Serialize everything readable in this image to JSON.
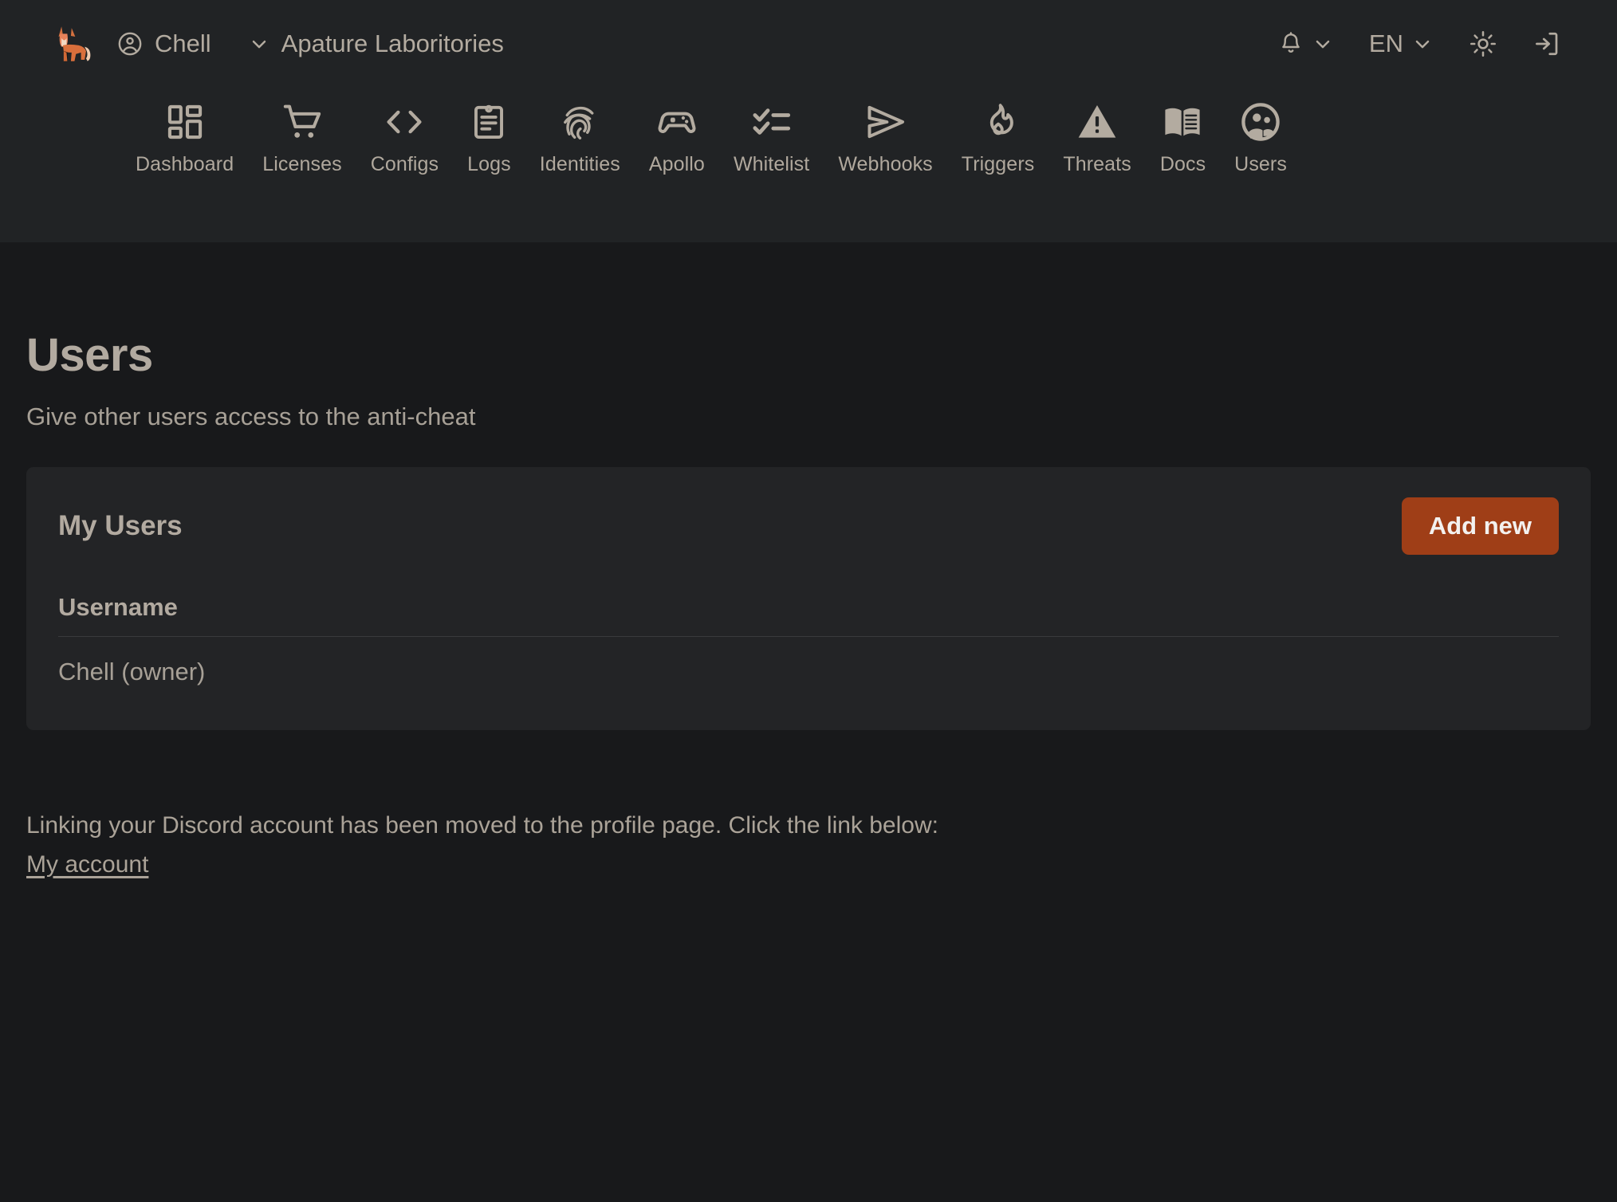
{
  "header": {
    "logo_icon": "fox-logo",
    "account": {
      "icon": "account-circle-icon",
      "label": "Chell"
    },
    "organization": {
      "icon": "chevron-down-icon",
      "label": "Apature Laboritories"
    },
    "right_controls": [
      {
        "name": "notifications",
        "icon": "bell-icon",
        "label": ""
      },
      {
        "name": "language",
        "icon": "chevron-down-icon",
        "label": "EN"
      },
      {
        "name": "theme-toggle",
        "icon": "sun-icon",
        "label": ""
      },
      {
        "name": "logout",
        "icon": "logout-icon",
        "label": ""
      }
    ]
  },
  "nav": {
    "items": [
      {
        "label": "Dashboard",
        "icon": "dashboard-grid-icon"
      },
      {
        "label": "Licenses",
        "icon": "shopping-cart-icon"
      },
      {
        "label": "Configs",
        "icon": "code-brackets-icon"
      },
      {
        "label": "Logs",
        "icon": "clipboard-icon"
      },
      {
        "label": "Identities",
        "icon": "fingerprint-icon"
      },
      {
        "label": "Apollo",
        "icon": "gamepad-icon"
      },
      {
        "label": "Whitelist",
        "icon": "checklist-icon"
      },
      {
        "label": "Webhooks",
        "icon": "send-icon"
      },
      {
        "label": "Triggers",
        "icon": "flame-icon"
      },
      {
        "label": "Threats",
        "icon": "warning-triangle-icon"
      },
      {
        "label": "Docs",
        "icon": "open-book-icon"
      },
      {
        "label": "Users",
        "icon": "group-icon"
      }
    ]
  },
  "page": {
    "title": "Users",
    "subtitle": "Give other users access to the anti-cheat"
  },
  "card": {
    "title": "My Users",
    "add_button": "Add new",
    "table": {
      "columns": [
        "Username"
      ],
      "rows": [
        [
          "Chell (owner)"
        ]
      ]
    }
  },
  "footer": {
    "note": "Linking your Discord account has been moved to the profile page. Click the link below:",
    "link": "My account"
  },
  "colors": {
    "accent": "#9f3e17",
    "header_bg": "#212325",
    "page_bg": "#18191b",
    "card_bg": "#232426",
    "text": "#b2aaa0"
  }
}
